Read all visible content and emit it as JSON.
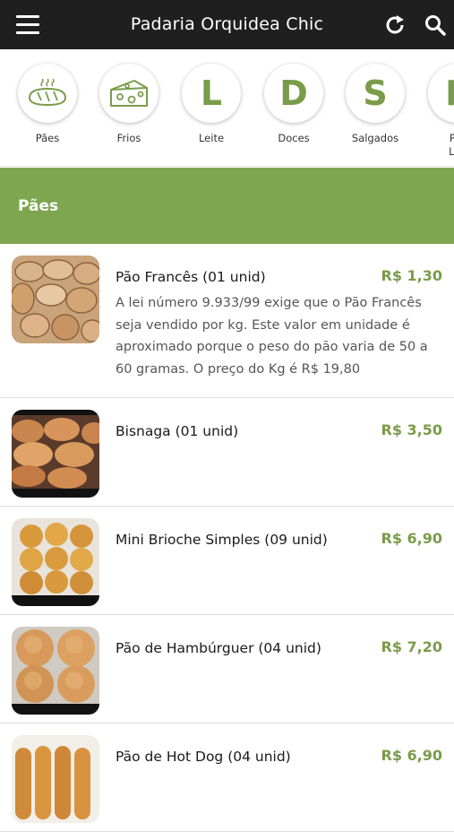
{
  "header": {
    "title": "Padaria Orquidea Chic"
  },
  "categories": [
    {
      "label": "Pães",
      "icon": "bread-icon"
    },
    {
      "label": "Frios",
      "icon": "cheese-icon"
    },
    {
      "label": "Leite",
      "letter": "L"
    },
    {
      "label": "Doces",
      "letter": "D"
    },
    {
      "label": "Salgados",
      "letter": "S"
    },
    {
      "label": "Pro\nLác",
      "letter": "P"
    }
  ],
  "section": {
    "title": "Pães"
  },
  "products": [
    {
      "name": "Pão Francês (01 unid)",
      "price": "R$ 1,30",
      "description": "A lei número 9.933/99 exige que o Pão Francês seja vendido por kg. Este valor em unidade é aproximado porque o peso do pão varia de 50 a 60 gramas. O preço do Kg é R$ 19,80"
    },
    {
      "name": "Bisnaga (01 unid)",
      "price": "R$ 3,50"
    },
    {
      "name": "Mini Brioche Simples (09 unid)",
      "price": "R$ 6,90"
    },
    {
      "name": "Pão de Hambúrguer (04 unid)",
      "price": "R$ 7,20"
    },
    {
      "name": "Pão de Hot Dog (04 unid)",
      "price": "R$ 6,90"
    }
  ],
  "colors": {
    "accent": "#7ea650",
    "price": "#7a9c4a",
    "topbar": "#1f1f1f"
  }
}
